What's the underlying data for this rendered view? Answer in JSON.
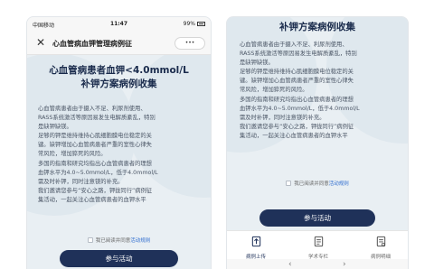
{
  "left": {
    "status": {
      "carrier": "中国移动 ",
      "time": "11:47",
      "battery": "99%"
    },
    "nav": {
      "close": "✕",
      "title": "心血管病血钾管理病例征",
      "more": "•••"
    },
    "title_line1": "心血管病患者血钾<4.0mmol/L",
    "title_line2": "补钾方案病例收集",
    "paragraphs": [
      "心血管病患者由于摄入不足、利尿剂使用、",
      "RASS系统激活等原因易发生电解质紊乱，特别",
      "是缺钾缺镁。",
      "足够的钾是维持维持心肌细胞膜电位稳定的关",
      "键。缺钾增加心血管病患者严重的室性心律失",
      "常风险，增加猝死的风险。",
      "多国的指南和研究均指出心血管病患者的理想",
      "血钾水平为4.0~5.0mmol/L，低于4.0mmol/L",
      "需及时补钾，同时注意镁的补充。",
      "我们邀请您参与“安心之路，钾拢同行”病例征",
      "集活动，一起关注心血管病患者的血钾水平"
    ],
    "consent_text": "我已阅读并同意",
    "consent_link": "活动规则",
    "button": "参与活动"
  },
  "right": {
    "title": "补钾方案病例收集",
    "paragraphs": [
      "心血管病患者由于摄入不足、利尿剂使用、",
      "RASS系统激活等原因易发生电解质紊乱，特别",
      "是缺钾缺镁。",
      "足够的钾是维持维持心肌细胞膜电位稳定的关",
      "键。缺钾增加心血管病患者严重的室性心律失",
      "常风险，增加猝死的风险。",
      "多国的指南和研究均指出心血管病患者的理想",
      "血钾水平为4.0~5.0mmol/L，低于4.0mmol/L",
      "需及时补钾，同时注意镁的补充。",
      "我们邀请您参与“安心之路，钾拢同行”病例征",
      "集活动，一起关注心血管病患者的血钾水平"
    ],
    "consent_text": "我已阅读并同意",
    "consent_link": "活动规则",
    "button": "参与活动",
    "tabs": [
      {
        "label": "病例上传",
        "icon": "upload-doc-icon"
      },
      {
        "label": "学术专栏",
        "icon": "academic-doc-icon"
      },
      {
        "label": "病例明细",
        "icon": "case-detail-icon"
      }
    ],
    "browser_nav": {
      "back": "‹",
      "forward": "›"
    }
  },
  "colors": {
    "primary": "#1f3159",
    "link": "#2f6dcf",
    "background": "#e9eff3"
  }
}
